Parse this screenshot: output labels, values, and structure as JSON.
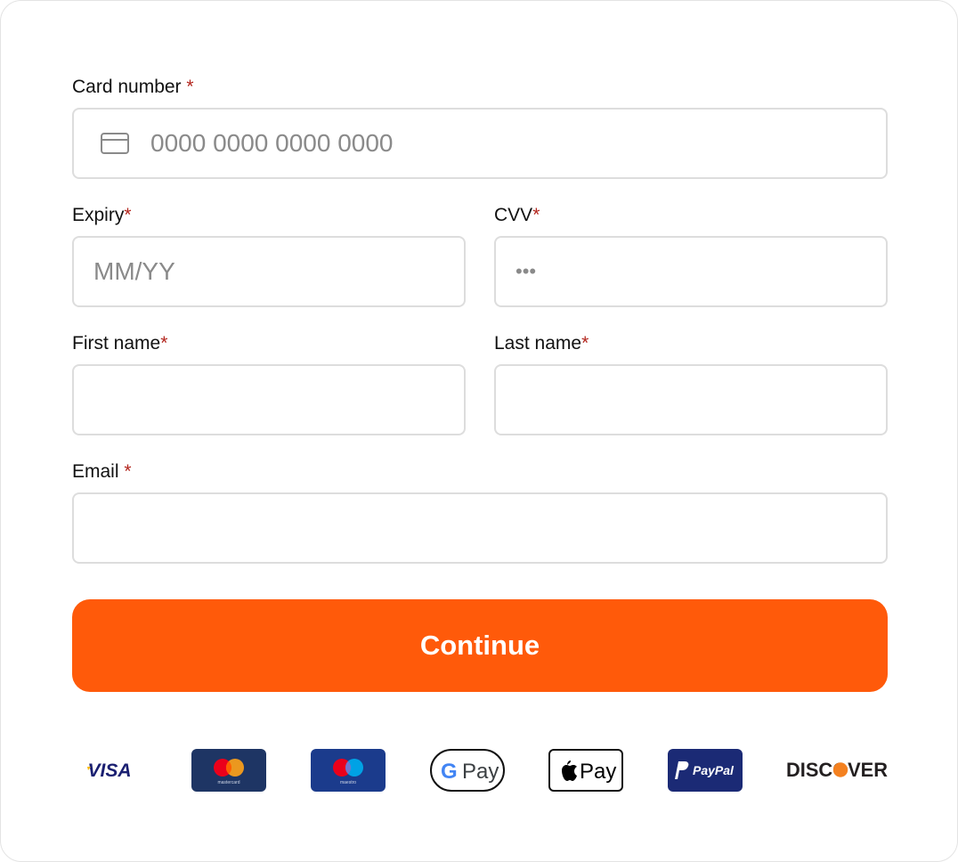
{
  "form": {
    "card_number": {
      "label": "Card number",
      "required_mark": "*",
      "placeholder": "0000 0000 0000 0000",
      "value": ""
    },
    "expiry": {
      "label": "Expiry",
      "required_mark": "*",
      "placeholder": "MM/YY",
      "value": ""
    },
    "cvv": {
      "label": "CVV",
      "required_mark": "*",
      "placeholder": "•••",
      "value": ""
    },
    "first_name": {
      "label": "First name",
      "required_mark": "*",
      "value": ""
    },
    "last_name": {
      "label": "Last name",
      "required_mark": "*",
      "value": ""
    },
    "email": {
      "label": "Email",
      "required_mark": "*",
      "value": ""
    },
    "continue_label": "Continue"
  },
  "payment_methods": [
    {
      "name": "VISA",
      "icon": "visa-logo"
    },
    {
      "name": "mastercard",
      "icon": "mastercard-logo"
    },
    {
      "name": "maestro",
      "icon": "maestro-logo"
    },
    {
      "name": "G Pay",
      "icon": "google-pay-logo"
    },
    {
      "name": "Pay",
      "icon": "apple-pay-logo"
    },
    {
      "name": "PayPal",
      "icon": "paypal-logo"
    },
    {
      "name": "DISCOVER",
      "icon": "discover-logo"
    }
  ],
  "colors": {
    "accent": "#ff5a0a",
    "required": "#b3261e",
    "border": "#dddddd",
    "placeholder": "#8a8a8a"
  }
}
